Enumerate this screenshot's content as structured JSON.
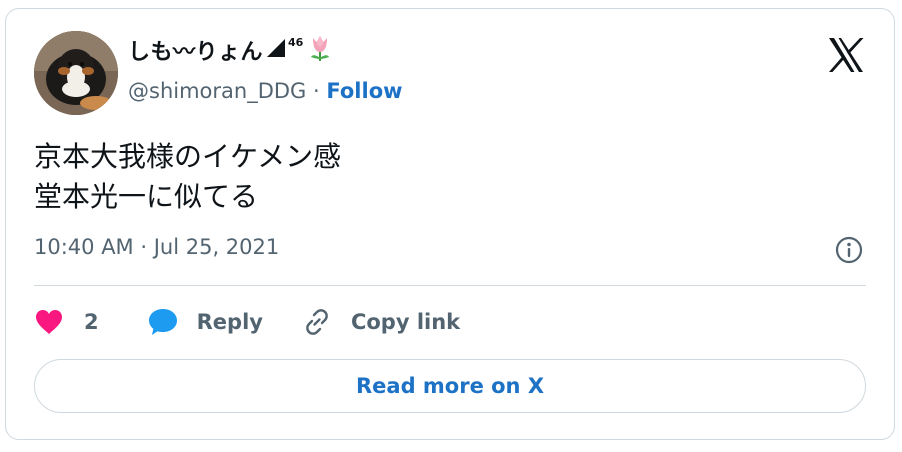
{
  "tweet": {
    "author": {
      "display_name": "しも〰りょん",
      "signal_superscript": "46",
      "handle": "@shimoran_DDG",
      "separator": "·",
      "follow_label": "Follow"
    },
    "text_lines": [
      "京本大我様のイケメン感",
      "堂本光一に似てる"
    ],
    "timestamp": "10:40 AM · Jul 25, 2021",
    "likes_count": "2",
    "reply_label": "Reply",
    "copy_link_label": "Copy link",
    "read_more_label": "Read more on X"
  },
  "colors": {
    "accent": "#1d72c6",
    "muted": "#536471",
    "heart": "#f91880",
    "reply_bubble": "#1d9bf0",
    "border": "#cfd9de"
  },
  "icons": [
    "x-logo-icon",
    "info-icon",
    "heart-icon",
    "reply-bubble-icon",
    "link-icon",
    "signal-icon",
    "tulip-icon"
  ]
}
